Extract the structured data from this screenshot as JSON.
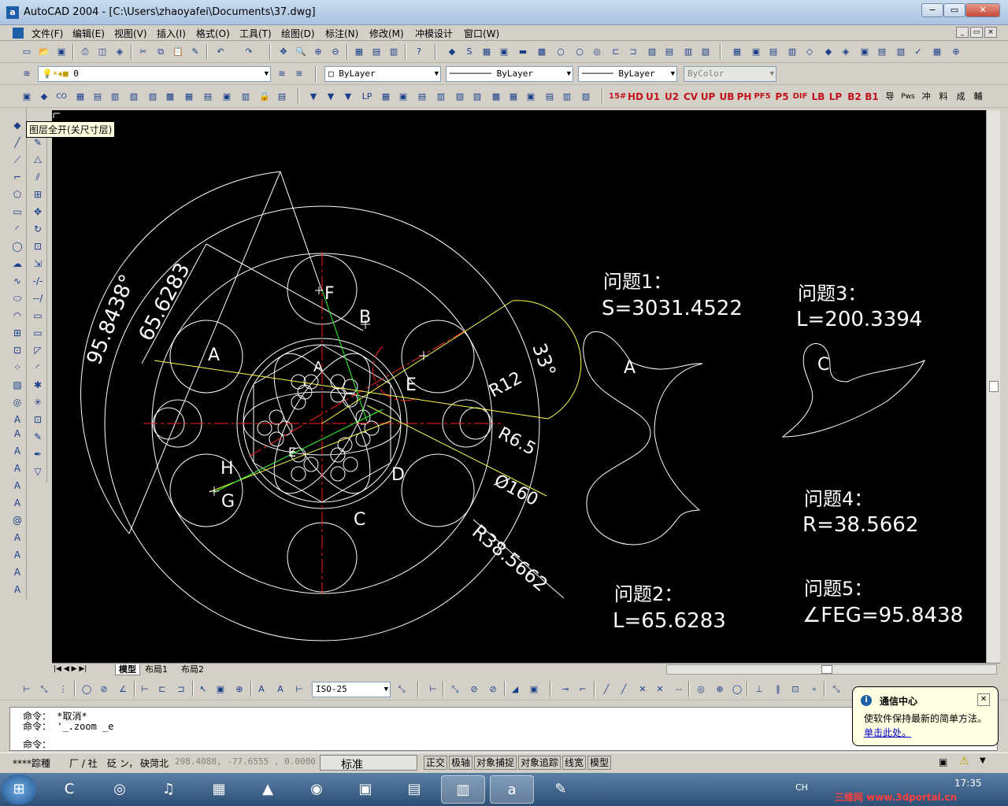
{
  "window": {
    "title": "AutoCAD 2004 - [C:\\Users\\zhaoyafei\\Documents\\37.dwg]",
    "app_icon": "a",
    "minimize": "−",
    "restore": "▭",
    "close": "✕"
  },
  "menu": [
    "文件(F)",
    "编辑(E)",
    "视图(V)",
    "插入(I)",
    "格式(O)",
    "工具(T)",
    "绘图(D)",
    "标注(N)",
    "修改(M)",
    "冲模设计",
    "窗口(W)"
  ],
  "layers_toolbar": {
    "layer_value": "0",
    "color_value": "ByLayer",
    "linetype_value": "ByLayer",
    "lineweight_value": "ByLayer",
    "plotstyle_value": "ByColor"
  },
  "red_toolbar_labels": [
    "15#",
    "HD",
    "U1",
    "U2",
    "CV",
    "UP",
    "UB",
    "PH",
    "PF5",
    "P5",
    "DIF",
    "LB",
    "LP",
    "B2",
    "B1",
    "导",
    "Pws",
    "冲",
    "料",
    "成",
    "輔"
  ],
  "tooltip": "图层全开(关尺寸层)",
  "drawing": {
    "labels": {
      "A": "A",
      "B": "B",
      "C": "C",
      "D": "D",
      "E": "E",
      "F": "F",
      "G": "G",
      "H": "H"
    },
    "dimensions": {
      "angle_large": "95.8438°",
      "length_mid": "65.6283",
      "angle_small": "33°",
      "r12": "R12",
      "r65": "R6.5",
      "d160": "Ø160",
      "r385": "R38.5662"
    },
    "questions": [
      {
        "title": "问题1：",
        "answer": "S=3031.4522"
      },
      {
        "title": "问题2：",
        "answer": "L=65.6283"
      },
      {
        "title": "问题3：",
        "answer": "L=200.3394"
      },
      {
        "title": "问题4：",
        "answer": "R=38.5662"
      },
      {
        "title": "问题5：",
        "answer": "∠FEG=95.8438"
      }
    ],
    "shape_labels": {
      "A": "A",
      "C": "C"
    }
  },
  "layout_tabs": [
    "模型",
    "布局1",
    "布局2"
  ],
  "dim_style_value": "ISO-25",
  "command_lines": [
    "命令： *取消*",
    "命令： '_.zoom _e",
    "命令："
  ],
  "status": {
    "left_text": "****踪種",
    "mid_text1": "厂 / 社",
    "mid_text2": "砭 ン，",
    "mid_text3": "砄菏北",
    "coords": "298.4088,  -77.6555 , 0.0000",
    "ime_label": "标准",
    "toggles": [
      "正交",
      "极轴",
      "对象捕捉",
      "对象追踪",
      "线宽",
      "模型"
    ]
  },
  "balloon": {
    "title": "通信中心",
    "body": "使软件保持最新的简单方法。",
    "link": "单击此处。",
    "close": "✕"
  },
  "taskbar": {
    "clock": "17:35",
    "lang": "CH",
    "watermark": "三维网 www.3dportal.cn"
  }
}
